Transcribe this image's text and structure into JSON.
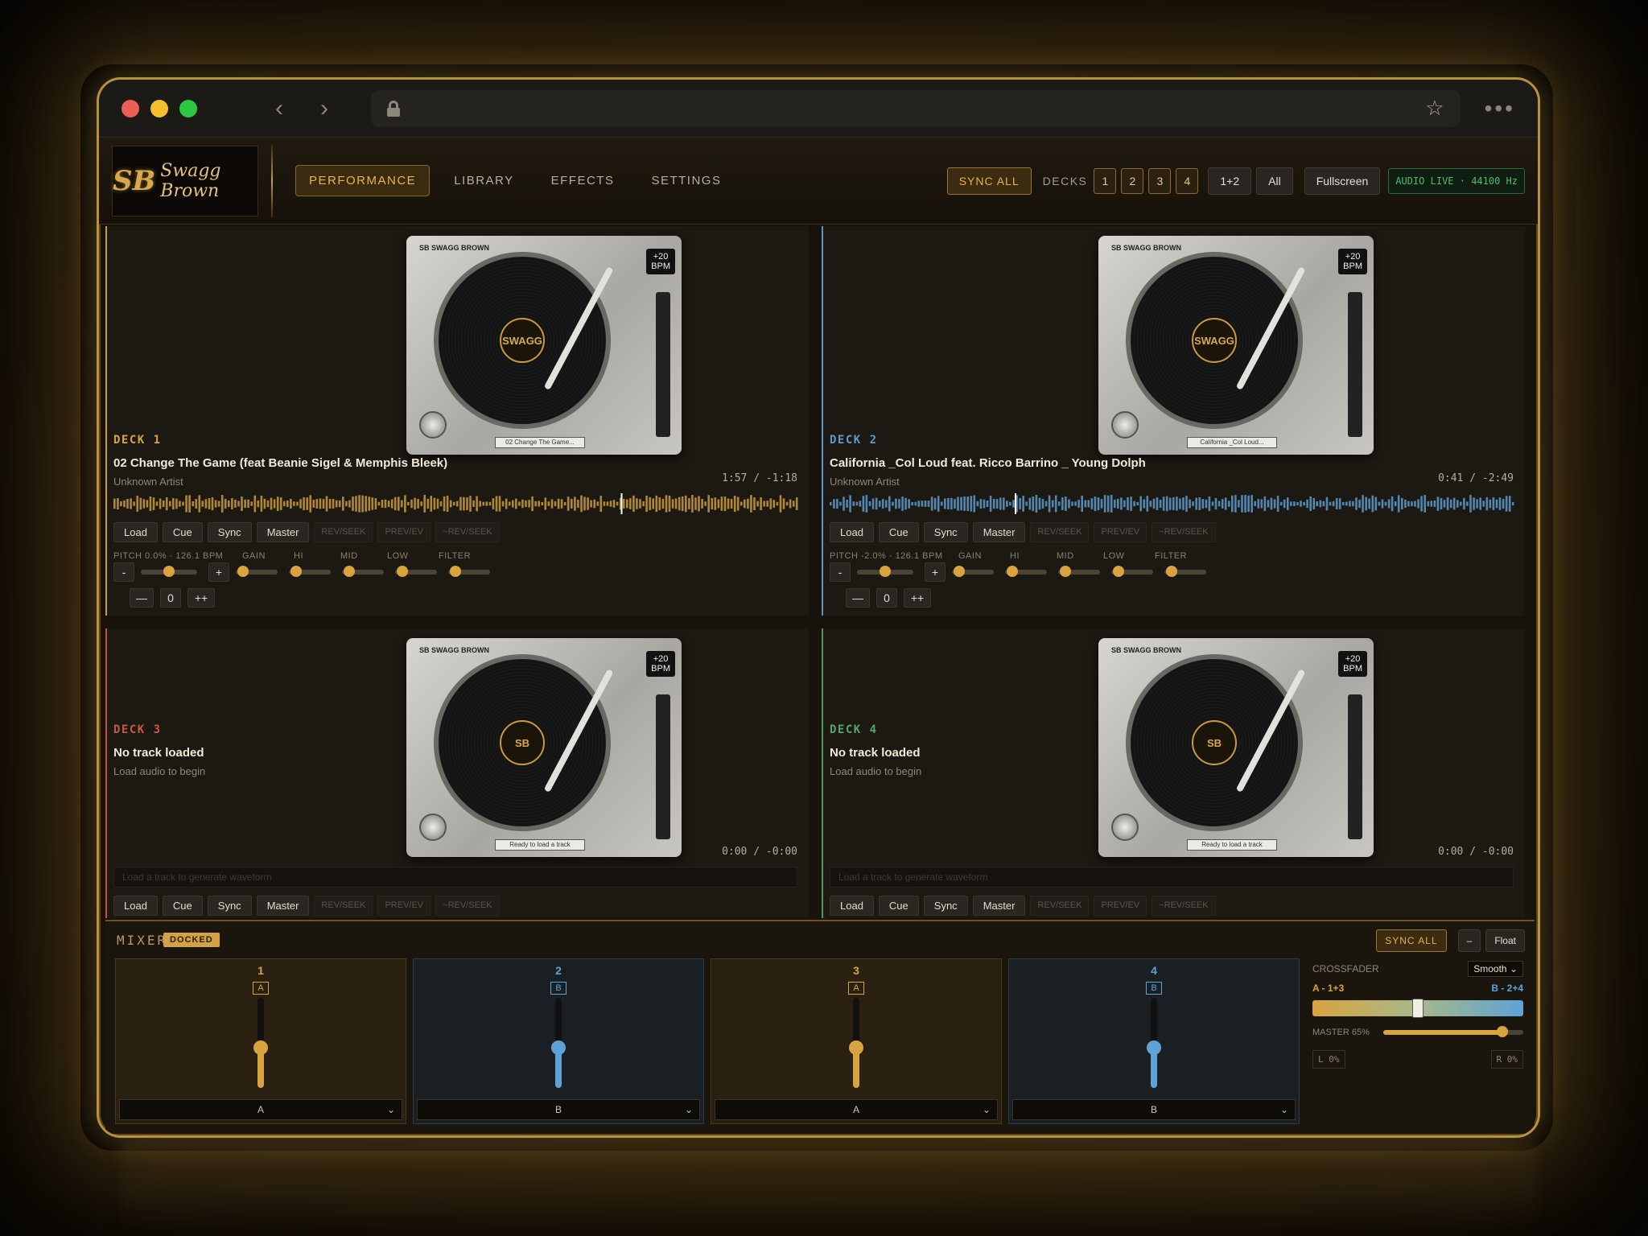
{
  "browser": {
    "back": "‹",
    "forward": "›",
    "star": "☆",
    "more": "•••"
  },
  "logo": {
    "mark": "SB",
    "word": "Swagg Brown"
  },
  "tabs": [
    {
      "label": "PERFORMANCE",
      "active": true
    },
    {
      "label": "LIBRARY",
      "active": false
    },
    {
      "label": "EFFECTS",
      "active": false
    },
    {
      "label": "SETTINGS",
      "active": false
    }
  ],
  "header": {
    "sync_all": "SYNC ALL",
    "decks_label": "DECKS",
    "deck_buttons": [
      "1",
      "2",
      "3",
      "4"
    ],
    "pair": "1+2",
    "all": "All",
    "fullscreen": "Fullscreen",
    "audio_live": "AUDIO LIVE · 44100 Hz"
  },
  "deck_controls": {
    "load": "Load",
    "cue": "Cue",
    "sync": "Sync",
    "master": "Master",
    "rev_seek": "REV/SEEK",
    "prev_rev": "PREV/EV",
    "rev_seek2": "~REV/SEEK",
    "gain": "GAIN",
    "hi": "HI",
    "mid": "MID",
    "low": "LOW",
    "filter": "FILTER",
    "minus": "-",
    "plus": "+",
    "dash": "—",
    "zero": "0",
    "plusplus": "++"
  },
  "decks": [
    {
      "label": "DECK 1",
      "title": "02 Change The Game (feat Beanie Sigel & Memphis Bleek)",
      "artist": "Unknown Artist",
      "time": "1:57 / -1:18",
      "pitch": "PITCH 0.0% · 126.1 BPM",
      "tt_track": "02 Change The Game...",
      "tt_label": "SWAGG",
      "color": "#c99b3e",
      "progress": 0.74
    },
    {
      "label": "DECK 2",
      "title": "California _Col Loud feat. Ricco Barrino _ Young Dolph",
      "artist": "Unknown Artist",
      "time": "0:41 / -2:49",
      "pitch": "PITCH -2.0% · 126.1 BPM",
      "tt_track": "California _Col Loud...",
      "tt_label": "SWAGG",
      "color": "#5d9acd",
      "progress": 0.27
    },
    {
      "label": "DECK 3",
      "title": "No track loaded",
      "artist": "Load audio to begin",
      "time": "0:00 / -0:00",
      "waveform_placeholder": "Load a track to generate waveform",
      "tt_track": "Ready to load a track",
      "tt_label": "SB",
      "color": "#c7593c"
    },
    {
      "label": "DECK 4",
      "title": "No track loaded",
      "artist": "Load audio to begin",
      "time": "0:00 / -0:00",
      "waveform_placeholder": "Load a track to generate waveform",
      "tt_track": "Ready to load a track",
      "tt_label": "SB",
      "color": "#55a566"
    }
  ],
  "turntable": {
    "brand": "SB SWAGG BROWN",
    "bpm": "BPM",
    "bpm_value": "+20"
  },
  "mixer": {
    "title": "MIXER",
    "docked": "DOCKED",
    "sync_all": "SYNC ALL",
    "minimize": "–",
    "float": "Float",
    "channels": [
      {
        "num": "1",
        "ab": "A",
        "assign": "A",
        "level": 0.45,
        "color": "#d9a43e"
      },
      {
        "num": "2",
        "ab": "B",
        "assign": "B",
        "level": 0.45,
        "color": "#5fa2d6"
      },
      {
        "num": "3",
        "ab": "A",
        "assign": "A",
        "level": 0.45,
        "color": "#d9a43e"
      },
      {
        "num": "4",
        "ab": "B",
        "assign": "B",
        "level": 0.45,
        "color": "#5fa2d6"
      }
    ],
    "crossfader": {
      "label": "CROSSFADER",
      "mode": "Smooth",
      "left": "A - 1+3",
      "right": "B - 2+4",
      "position": 0.5
    },
    "master": {
      "label": "MASTER 65%",
      "value": 0.85
    },
    "meter_l": "L 0%",
    "meter_r": "R 0%"
  }
}
